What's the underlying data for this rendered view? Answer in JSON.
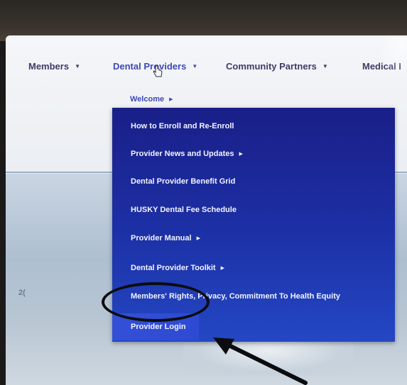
{
  "nav": {
    "items": [
      {
        "label": "Members",
        "has_dropdown": true
      },
      {
        "label": "Dental Providers",
        "has_dropdown": true,
        "active": true
      },
      {
        "label": "Community Partners",
        "has_dropdown": true
      },
      {
        "label": "Medical I"
      }
    ]
  },
  "submenu": {
    "welcome": {
      "label": "Welcome",
      "has_submenu": true
    },
    "items": [
      {
        "label": "How to Enroll and Re-Enroll"
      },
      {
        "label": "Provider News and Updates",
        "has_submenu": true
      },
      {
        "label": "Dental Provider Benefit Grid"
      },
      {
        "label": "HUSKY Dental Fee Schedule"
      },
      {
        "label": "Provider Manual",
        "has_submenu": true
      },
      {
        "label": "Dental Provider Toolkit",
        "has_submenu": true
      },
      {
        "label": "Members' Rights, Privacy, Commitment To Health Equity"
      },
      {
        "label": "Provider Login",
        "highlighted": true
      }
    ]
  },
  "hero": {
    "small_text": "2("
  },
  "colors": {
    "nav_text": "#3d3d66",
    "active_accent": "#3c49b5",
    "dropdown_bg": "#1c2fa4",
    "menu_text": "#f2f4ff"
  },
  "annotations": {
    "circle_target": "Provider Login",
    "arrow_icon": "arrow-up-left-icon"
  }
}
